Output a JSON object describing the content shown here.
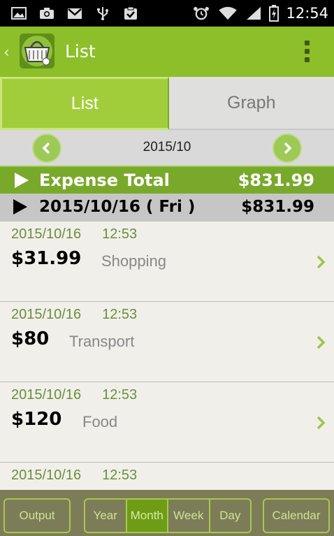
{
  "status_bar": {
    "time": "12:54",
    "left_icons": [
      "image-icon",
      "camera-icon",
      "gmail-icon",
      "usb-icon",
      "clipboard-check-icon"
    ],
    "right_icons": [
      "alarm-icon",
      "wifi-icon",
      "signal-icon",
      "battery-icon"
    ]
  },
  "action_bar": {
    "title": "List"
  },
  "tabs": [
    {
      "label": "List",
      "active": true
    },
    {
      "label": "Graph",
      "active": false
    }
  ],
  "month_nav": {
    "month": "2015/10"
  },
  "total": {
    "label": "Expense Total",
    "amount": "$831.99"
  },
  "day_header": {
    "date": "2015/10/16 ( Fri )",
    "amount": "$831.99"
  },
  "entries": [
    {
      "date": "2015/10/16",
      "time": "12:53",
      "amount": "$31.99",
      "category": "Shopping"
    },
    {
      "date": "2015/10/16",
      "time": "12:53",
      "amount": "$80",
      "category": "Transport"
    },
    {
      "date": "2015/10/16",
      "time": "12:53",
      "amount": "$120",
      "category": "Food"
    },
    {
      "date": "2015/10/16",
      "time": "12:53",
      "amount": "",
      "category": ""
    }
  ],
  "bottom_bar": {
    "output_label": "Output",
    "periods": [
      {
        "label": "Year",
        "active": false
      },
      {
        "label": "Month",
        "active": true
      },
      {
        "label": "Week",
        "active": false
      },
      {
        "label": "Day",
        "active": false
      }
    ],
    "calendar_label": "Calendar"
  },
  "colors": {
    "accent": "#8cbf2a",
    "total_bar": "#79a92b",
    "date_text": "#6b8e3a",
    "bottom_bar": "#7c7c59"
  }
}
